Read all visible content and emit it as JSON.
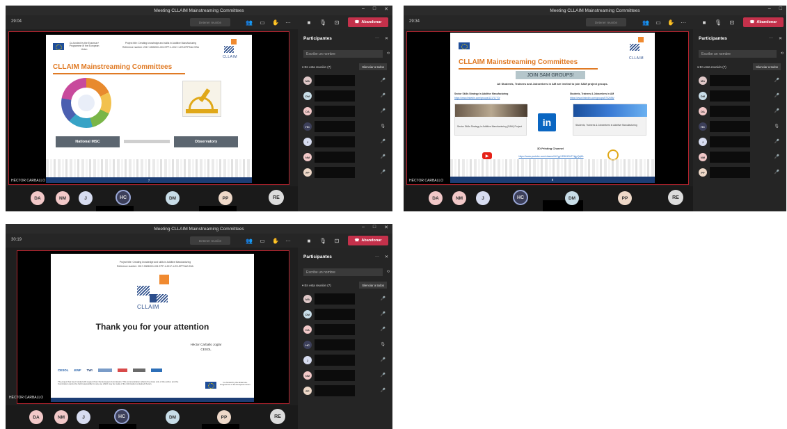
{
  "meeting_title": "Meeting CLLAIM Mainstreaming Committees",
  "toolbar": {
    "stop_sharing": "Detener reunión",
    "leave": "Abandonar"
  },
  "panel": {
    "title": "Participantes",
    "search_placeholder": "Escribe un nombre",
    "in_meeting": "En esta reunión (7)",
    "mute_all": "Silenciar a todos",
    "participants": [
      {
        "initials": "MA"
      },
      {
        "initials": "DM"
      },
      {
        "initials": "DA"
      },
      {
        "initials": "HC"
      },
      {
        "initials": "J"
      },
      {
        "initials": "NM"
      },
      {
        "initials": "PP"
      }
    ]
  },
  "gallery": [
    "DA",
    "NM",
    "J",
    "HC",
    "DM",
    "PP",
    "RE"
  ],
  "presenter": "HÉCTOR CARBALLO",
  "colors": {
    "brand_orange": "#e07a24",
    "brand_navy": "#1c3d74",
    "leave_red": "#c4314b",
    "stage_border": "#b8242f"
  },
  "screens": [
    {
      "timer": "29:04",
      "slide": {
        "project_title": "Project title: Creating knowledge and skills in Additive Manufacturing",
        "reference": "Reference number: 2017-3305/001-001 EPP-1-2017-1-ES-EPPKA2-SSA",
        "eu_text": "Co-funded by the Erasmus+ Programme of the European Union",
        "logo": "CLLAIM",
        "heading": "CLLAIM Mainstreaming Committees",
        "box_left": "National MSC",
        "box_right": "Observatory",
        "page": "7"
      }
    },
    {
      "timer": "29:34",
      "slide": {
        "heading": "CLLAIM Mainstreaming Committees",
        "banner": "JOIN SAM GROUPS!",
        "invite": "All Students, Trainees and Jobseekers in AM are invited to join SAM project groups.",
        "group1_title": "Sector Skills Strategy in Additive Manufacturing",
        "group1_url": "https://www.linkedin.com/groups/12171770/",
        "group1_caption": "Sector Skills Strategy in Additive Manufacturing (SAM) Project",
        "group2_title": "Students, Trainees & Jobseekers in AM",
        "group2_url": "https://www.linkedin.com/groups/8702656/",
        "group2_caption": "Students, Trainees & Jobseekers in Additive Manufacturing",
        "channel_title": "3D Printing Channel",
        "channel_url": "https://www.youtube.com/channel/UCgpYE8H1SbTYlgjyQq5A",
        "logo": "CLLAIM",
        "page": "8"
      }
    },
    {
      "timer": "30:19",
      "slide": {
        "project_title": "Project title: Creating knowledge and skills in Additive Manufacturing",
        "reference": "Reference number: 2017-3305/001-001 EPP-1-2017-1-ES-EPPKA2-SSA",
        "logo": "CLLAIM",
        "thanks": "Thank you for your attention",
        "speaker": "Héctor Carballo Joglar",
        "org": "CESOL",
        "partners": [
          "CESOL",
          "EWF",
          "TWI"
        ],
        "disclaimer": "The project has been funded with support from the European Commission. This communication reflects the views only of the author, and the Commission cannot be held responsible for any use which may be made of the information contained therein.",
        "eu_text": "Co-funded by the Erasmus+ Programme of the European Union"
      }
    }
  ]
}
